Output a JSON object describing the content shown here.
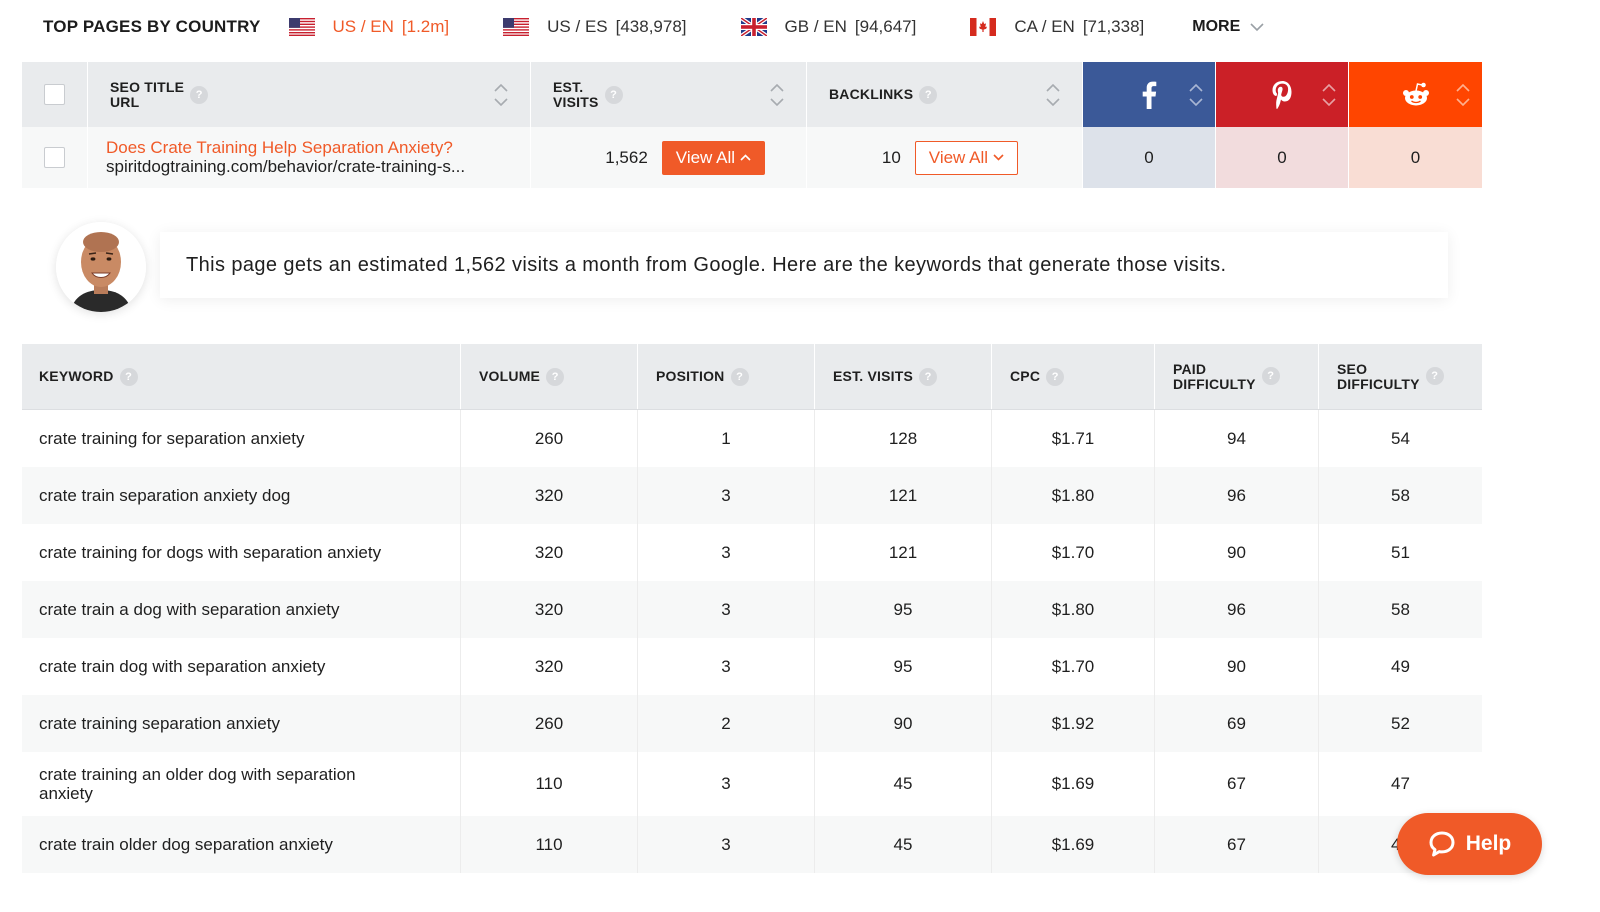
{
  "country_bar": {
    "title": "TOP PAGES BY COUNTRY",
    "countries": [
      {
        "code": "US / EN",
        "count": "[1.2m]",
        "flag": "us-flag",
        "active": true
      },
      {
        "code": "US / ES",
        "count": "[438,978]",
        "flag": "us-flag",
        "active": false
      },
      {
        "code": "GB / EN",
        "count": "[94,647]",
        "flag": "gb-flag",
        "active": false
      },
      {
        "code": "CA / EN",
        "count": "[71,338]",
        "flag": "ca-flag",
        "active": false
      }
    ],
    "more_label": "MORE"
  },
  "top_table": {
    "headers": {
      "seo_title": "SEO TITLE",
      "url": "URL",
      "est": "EST.",
      "visits": "VISITS",
      "backlinks": "BACKLINKS",
      "help_glyph": "?"
    },
    "social_icons": [
      "facebook-icon",
      "pinterest-icon",
      "reddit-icon"
    ],
    "row": {
      "title": "Does Crate Training Help Separation Anxiety?",
      "url": "spiritdogtraining.com/behavior/crate-training-s...",
      "est_visits": "1,562",
      "visits_button": "View All",
      "backlinks": "10",
      "backlinks_button": "View All",
      "facebook": "0",
      "pinterest": "0",
      "reddit": "0"
    }
  },
  "message": {
    "text": "This page gets an estimated 1,562 visits a month from Google. Here are the keywords that generate those visits."
  },
  "keyword_table": {
    "headers": {
      "keyword": "KEYWORD",
      "volume": "VOLUME",
      "position": "POSITION",
      "est_visits": "EST. VISITS",
      "cpc": "CPC",
      "paid_1": "PAID",
      "paid_2": "DIFFICULTY",
      "seo_1": "SEO",
      "seo_2": "DIFFICULTY"
    },
    "rows": [
      {
        "keyword": "crate training for separation anxiety",
        "volume": "260",
        "position": "1",
        "visits": "128",
        "cpc": "$1.71",
        "paid": "94",
        "seo": "54"
      },
      {
        "keyword": "crate train separation anxiety dog",
        "volume": "320",
        "position": "3",
        "visits": "121",
        "cpc": "$1.80",
        "paid": "96",
        "seo": "58"
      },
      {
        "keyword": "crate training for dogs with separation anxiety",
        "volume": "320",
        "position": "3",
        "visits": "121",
        "cpc": "$1.70",
        "paid": "90",
        "seo": "51"
      },
      {
        "keyword": "crate train a dog with separation anxiety",
        "volume": "320",
        "position": "3",
        "visits": "95",
        "cpc": "$1.80",
        "paid": "96",
        "seo": "58"
      },
      {
        "keyword": "crate train dog with separation anxiety",
        "volume": "320",
        "position": "3",
        "visits": "95",
        "cpc": "$1.70",
        "paid": "90",
        "seo": "49"
      },
      {
        "keyword": "crate training separation anxiety",
        "volume": "260",
        "position": "2",
        "visits": "90",
        "cpc": "$1.92",
        "paid": "69",
        "seo": "52"
      },
      {
        "keyword": "crate training an older dog with separation anxiety",
        "volume": "110",
        "position": "3",
        "visits": "45",
        "cpc": "$1.69",
        "paid": "67",
        "seo": "47"
      },
      {
        "keyword": "crate train older dog separation anxiety",
        "volume": "110",
        "position": "3",
        "visits": "45",
        "cpc": "$1.69",
        "paid": "67",
        "seo": "47"
      }
    ]
  },
  "help": {
    "label": "Help"
  },
  "colors": {
    "accent": "#f05a28",
    "facebook": "#3b5998",
    "pinterest": "#cb2027",
    "reddit": "#ff4500",
    "header_bg": "#e9ebed"
  }
}
